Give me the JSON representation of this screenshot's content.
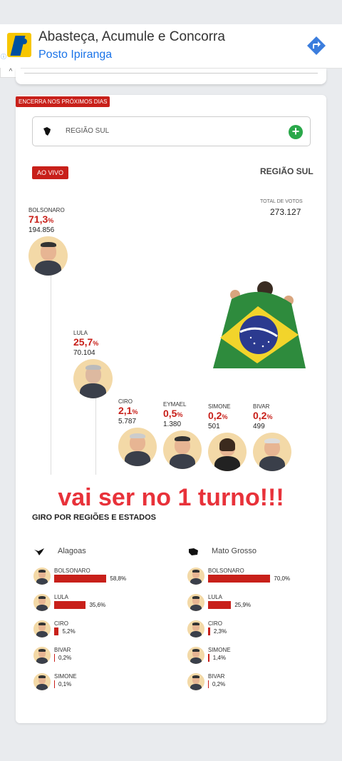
{
  "ad": {
    "title": "Abasteça, Acumule e Concorra",
    "subtitle": "Posto Ipiranga",
    "info_label": "ⓘ",
    "close_label": "^"
  },
  "card": {
    "ends_tag": "ENCERRA NOS PRÓXIMOS DIAS",
    "region_select": "REGIÃO SUL",
    "live_tag": "AO VIVO",
    "region_title": "REGIÃO SUL",
    "total_label": "TOTAL DE VOTOS",
    "total_votes": "273.127"
  },
  "candidates": [
    {
      "name": "BOLSONARO",
      "pct": "71,3",
      "votes": "194.856"
    },
    {
      "name": "LULA",
      "pct": "25,7",
      "votes": "70.104"
    },
    {
      "name": "CIRO",
      "pct": "2,1",
      "votes": "5.787"
    },
    {
      "name": "EYMAEL",
      "pct": "0,5",
      "votes": "1.380"
    },
    {
      "name": "SIMONE",
      "pct": "0,2",
      "votes": "501"
    },
    {
      "name": "BIVAR",
      "pct": "0,2",
      "votes": "499"
    }
  ],
  "pct_unit": "%",
  "overlay_text": "vai ser no 1 turno!!!",
  "section_title": "GIRO POR REGIÕES E ESTADOS",
  "states": [
    {
      "name": "Alagoas",
      "rows": [
        {
          "name": "BOLSONARO",
          "value": 58.8,
          "label": "58,8%"
        },
        {
          "name": "LULA",
          "value": 35.6,
          "label": "35,6%"
        },
        {
          "name": "CIRO",
          "value": 5.2,
          "label": "5,2%"
        },
        {
          "name": "BIVAR",
          "value": 0.2,
          "label": "0,2%"
        },
        {
          "name": "SIMONE",
          "value": 0.1,
          "label": "0,1%"
        }
      ]
    },
    {
      "name": "Mato Grosso",
      "rows": [
        {
          "name": "BOLSONARO",
          "value": 70.0,
          "label": "70,0%"
        },
        {
          "name": "LULA",
          "value": 25.9,
          "label": "25,9%"
        },
        {
          "name": "CIRO",
          "value": 2.3,
          "label": "2,3%"
        },
        {
          "name": "SIMONE",
          "value": 1.4,
          "label": "1,4%"
        },
        {
          "name": "BIVAR",
          "value": 0.2,
          "label": "0,2%"
        }
      ]
    }
  ],
  "colors": {
    "accent": "#c8201a",
    "overlay": "#e8323a",
    "add": "#2aa84a",
    "link": "#1a73e8"
  }
}
